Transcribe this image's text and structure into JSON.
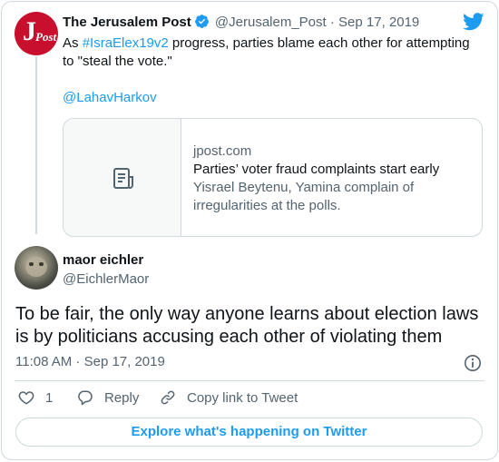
{
  "parent_tweet": {
    "author_name": "The Jerusalem Post",
    "author_handle": "@Jerusalem_Post",
    "separator": "·",
    "date": "Sep 17, 2019",
    "text_before": "As ",
    "hashtag": "#IsraElex19v2",
    "text_after": " progress, parties blame each other for attempting to \"steal the vote.\"",
    "mention": "@LahavHarkov",
    "avatar_letters": {
      "big": "J",
      "small": "Post"
    },
    "link_card": {
      "domain": "jpost.com",
      "title": "Parties’ voter fraud complaints start early",
      "description": "Yisrael Beytenu, Yamina complain of irregularities at the polls."
    }
  },
  "main_tweet": {
    "author_name": "maor eichler",
    "author_handle": "@EichlerMaor",
    "text": "To be fair, the only way anyone learns about election laws is by politicians accusing each other of violating them",
    "timestamp": "11:08 AM · Sep 17, 2019"
  },
  "actions": {
    "like_count": "1",
    "reply_label": "Reply",
    "copy_link_label": "Copy link to Tweet"
  },
  "explore_button_label": "Explore what's happening on Twitter",
  "colors": {
    "accent": "#1d9bf0",
    "text_primary": "#0f1419",
    "text_secondary": "#536471",
    "border": "#cfd9de",
    "jpost_red": "#c8102e"
  },
  "icons": [
    "verified-badge-icon",
    "twitter-bird-icon",
    "document-icon",
    "info-icon",
    "heart-icon",
    "reply-icon",
    "link-icon"
  ]
}
